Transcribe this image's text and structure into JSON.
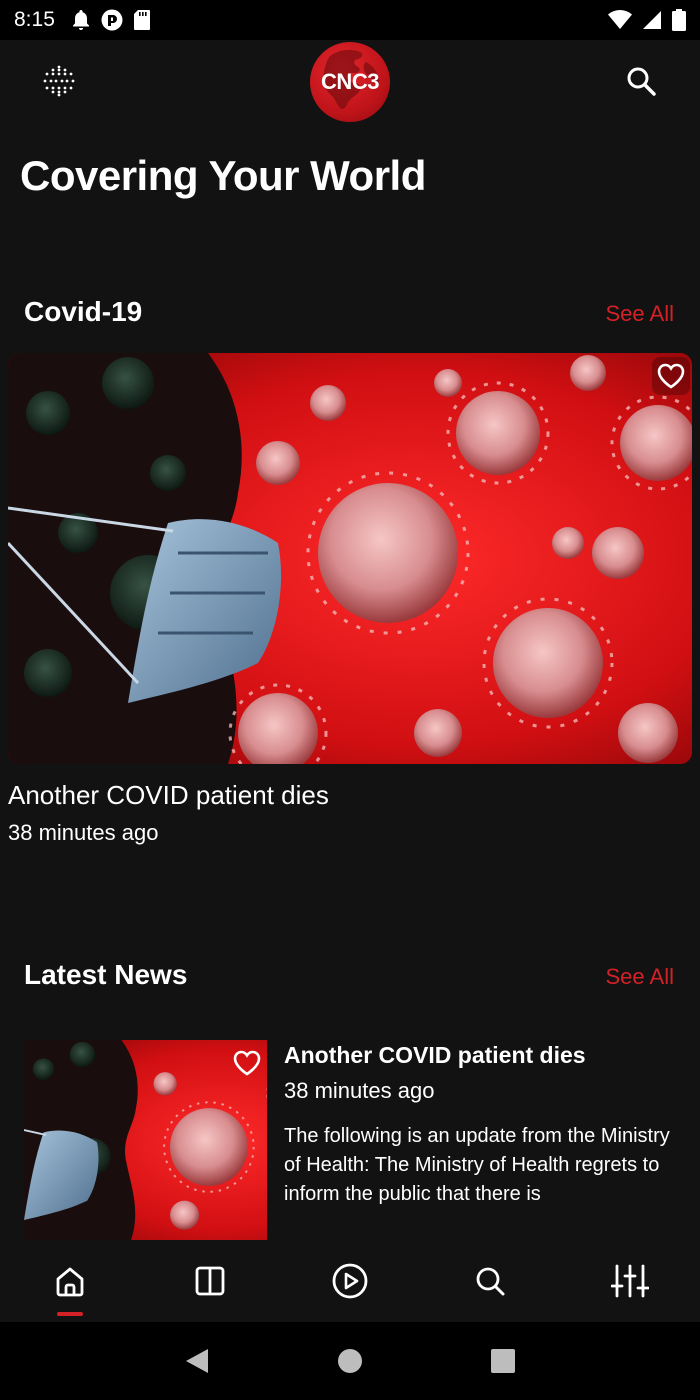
{
  "status_bar": {
    "time": "8:15"
  },
  "header": {
    "logo_text": "CNC3",
    "menu_icon": "dots-grid-icon",
    "search_icon": "search-icon"
  },
  "hero": {
    "title": "Covering Your World"
  },
  "sections": {
    "covid": {
      "title": "Covid-19",
      "see_all": "See All",
      "featured": {
        "title": "Another COVID patient dies",
        "time": "38 minutes ago"
      }
    },
    "latest": {
      "title": "Latest News",
      "see_all": "See All",
      "items": [
        {
          "title": "Another COVID patient dies",
          "time": "38 minutes ago",
          "excerpt": "The following is an update from the Ministry of Health: The Ministry of Health regrets to inform the public that there is"
        }
      ]
    }
  },
  "bottom_nav": {
    "items": [
      "home-icon",
      "columns-icon",
      "play-icon",
      "search-icon",
      "sliders-icon"
    ],
    "active": 0
  },
  "colors": {
    "accent": "#d42127",
    "background": "#121212"
  }
}
